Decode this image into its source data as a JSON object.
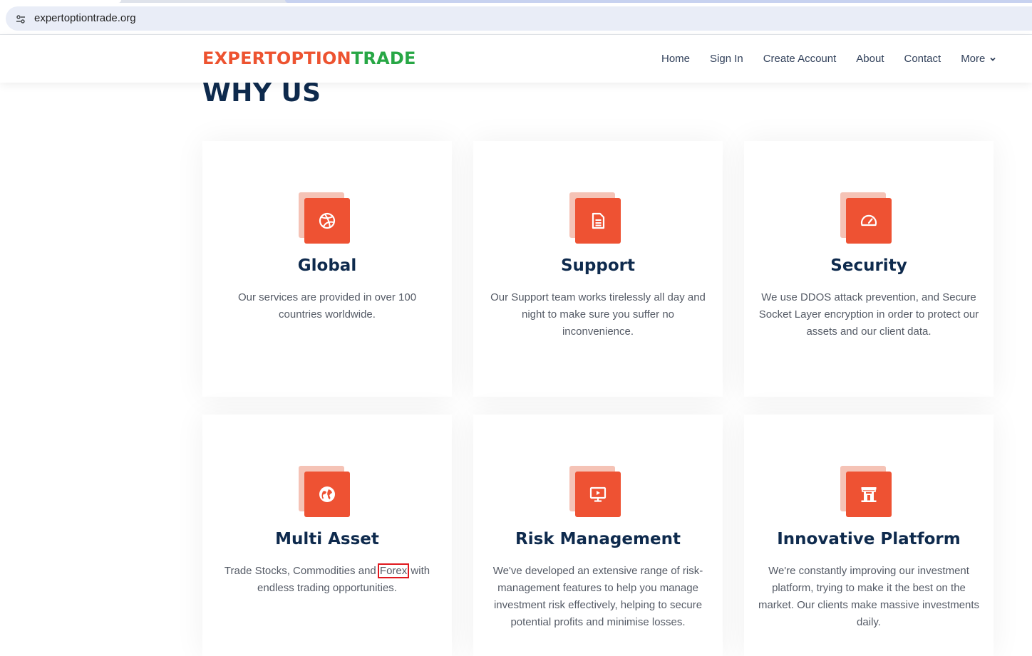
{
  "browser": {
    "url": "expertoptiontrade.org"
  },
  "header": {
    "logo_part1": "EXPERTOPTION",
    "logo_part2": "TRADE",
    "nav": [
      "Home",
      "Sign In",
      "Create Account",
      "About",
      "Contact"
    ],
    "more_label": "More"
  },
  "section": {
    "title": "WHY US"
  },
  "cards": [
    {
      "icon": "dribbble-icon",
      "title": "Global",
      "text": "Our services are provided in over 100 countries worldwide."
    },
    {
      "icon": "document-icon",
      "title": "Support",
      "text": "Our Support team works tirelessly all day and night to make sure you suffer no inconvenience."
    },
    {
      "icon": "speedometer-icon",
      "title": "Security",
      "text": "We use DDOS attack prevention, and Secure Socket Layer encryption in order to protect our assets and our client data."
    },
    {
      "icon": "globe-icon",
      "title": "Multi Asset",
      "text_before": "Trade Stocks, Commodities and ",
      "text_highlight": "Forex",
      "text_after": " with endless trading opportunities."
    },
    {
      "icon": "presentation-icon",
      "title": "Risk Management",
      "text": "We've developed an extensive range of risk-management features to help you manage investment risk effectively, helping to secure potential profits and minimise losses."
    },
    {
      "icon": "bank-icon",
      "title": "Innovative Platform",
      "text": "We're constantly improving our investment platform, trying to make it the best on the market. Our clients make massive investments daily."
    }
  ],
  "colors": {
    "accent": "#ee5233",
    "accent_light": "#f5c3b6",
    "logo_green": "#27a745",
    "heading": "#0e2a4d",
    "highlight_box": "#e0191f"
  }
}
